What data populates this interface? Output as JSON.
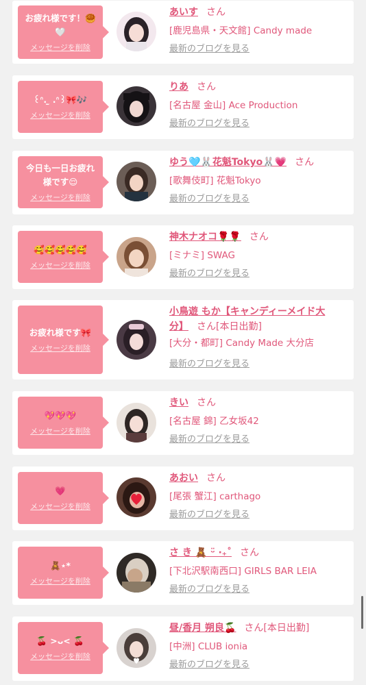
{
  "delete_label": "メッセージを削除",
  "blog_label": "最新のブログを見る",
  "san_label": "さん",
  "colors": {
    "accent": "#f6909f",
    "name": "#e0577a",
    "bg": "#f1f1f1"
  },
  "items": [
    {
      "message": "お疲れ様です！🥮🤍",
      "name": "あいす",
      "extra": "",
      "shop": "[鹿児島県・天文館] Candy made"
    },
    {
      "message": "꒰ᐢ. ̫ .ᐢ꒱🎀🎶",
      "name": "りあ",
      "extra": "",
      "shop": "[名古屋 金山] Ace Production"
    },
    {
      "message": "今日も一日お疲れ様です😌",
      "name": "ゆう🩵🐰花魁Tokyo🐰💗",
      "extra": "",
      "shop": "[歌舞伎町] 花魁Tokyo"
    },
    {
      "message": "🥰🥰🥰🥰🥰",
      "name": "神木ナオコ🌹🌹",
      "extra": "",
      "shop": "[ミナミ] SWAG"
    },
    {
      "message": "お疲れ様です🎀",
      "name": "小鳥遊 もか【キャンディーメイド大分】",
      "extra": "[本日出勤]",
      "shop": "[大分・都町] Candy Made 大分店"
    },
    {
      "message": "💖💖💖",
      "name": "きい",
      "extra": "",
      "shop": "[名古屋 錦] 乙女坂42"
    },
    {
      "message": "💗",
      "name": "あおい",
      "extra": "",
      "shop": "[尾張 蟹江] carthago"
    },
    {
      "message": "🧸⋆*",
      "name": "さ き 🧸 ᵕ̈ ‧₊˚",
      "extra": "",
      "shop": "[下北沢駅南西口] GIRLS BAR LEIA"
    },
    {
      "message": "🍒 >ᴗ< 🍒",
      "name": "昼/香月 朔良🍒",
      "extra": "[本日出勤]",
      "shop": "[中洲] CLUB ionia"
    }
  ]
}
